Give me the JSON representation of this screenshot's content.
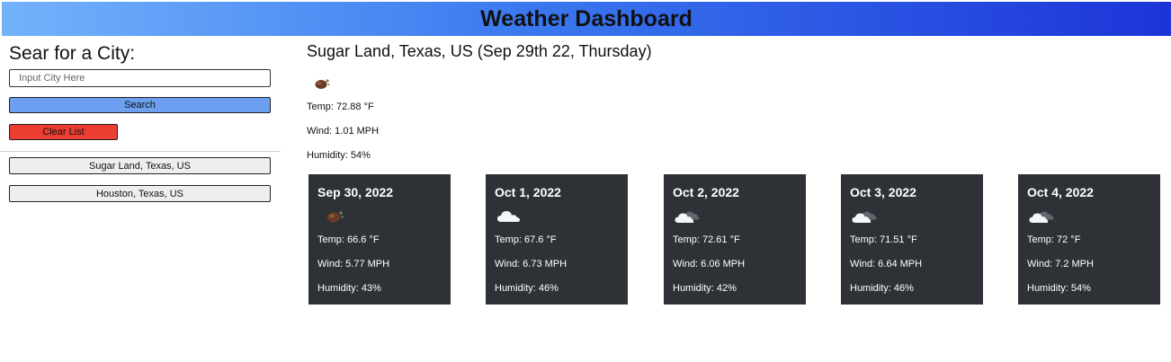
{
  "header": {
    "title": "Weather Dashboard"
  },
  "sidebar": {
    "heading": "Sear for a City:",
    "input_placeholder": "Input City Here",
    "search_label": "Search",
    "clear_label": "Clear List",
    "history": [
      "Sugar Land, Texas, US",
      "Houston, Texas, US"
    ]
  },
  "current": {
    "title": "Sugar Land, Texas, US (Sep 29th 22, Thursday)",
    "icon": "smoke-icon",
    "temp": "Temp: 72.88 °F",
    "wind": "Wind: 1.01 MPH",
    "humidity": "Humidity: 54%"
  },
  "forecast": [
    {
      "date": "Sep 30, 2022",
      "icon": "smoke-icon",
      "temp": "Temp: 66.6 °F",
      "wind": "Wind: 5.77 MPH",
      "humidity": "Humidity: 43%"
    },
    {
      "date": "Oct 1, 2022",
      "icon": "cloud-icon",
      "temp": "Temp: 67.6 °F",
      "wind": "Wind: 6.73 MPH",
      "humidity": "Humidity: 46%"
    },
    {
      "date": "Oct 2, 2022",
      "icon": "broken-clouds-icon",
      "temp": "Temp: 72.61 °F",
      "wind": "Wind: 6.06 MPH",
      "humidity": "Humidity: 42%"
    },
    {
      "date": "Oct 3, 2022",
      "icon": "broken-clouds-icon",
      "temp": "Temp: 71.51 °F",
      "wind": "Wind: 6.64 MPH",
      "humidity": "Humidity: 46%"
    },
    {
      "date": "Oct 4, 2022",
      "icon": "broken-clouds-icon",
      "temp": "Temp: 72 °F",
      "wind": "Wind: 7.2 MPH",
      "humidity": "Humidity: 54%"
    }
  ],
  "colors": {
    "header_gradient_start": "#73b3fb",
    "header_gradient_end": "#1c34d8",
    "search_button": "#6d9ff0",
    "clear_button": "#ec3d32",
    "card_background": "#2e3237"
  }
}
